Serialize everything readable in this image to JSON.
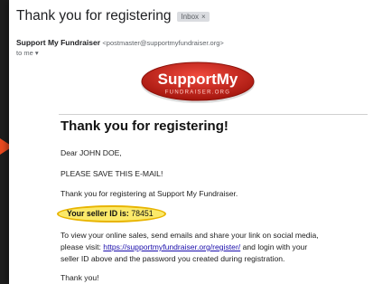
{
  "email": {
    "subject": "Thank you for registering",
    "label_badge": "Inbox",
    "label_close": "×",
    "sender_name": "Support My Fundraiser",
    "sender_email": "<postmaster@supportmyfundraiser.org>",
    "recipient": "to me ▾"
  },
  "logo": {
    "main": "SupportMy",
    "sub": "FUNDRAISER.ORG",
    "colors": {
      "oval": "#d9261c",
      "main_text": "#ffffff",
      "sub_text": "#ffd2cc"
    }
  },
  "body": {
    "heading": "Thank you for registering!",
    "greeting": "Dear JOHN DOE,",
    "save_notice": "PLEASE SAVE THIS E-MAIL!",
    "thanks_line": "Thank you for registering at Support My Fundraiser.",
    "seller_label": "Your seller ID is:",
    "seller_id": "78451",
    "instructions_1": "To view your online sales, send emails and share your link on social media,",
    "instructions_2_pre": "please visit: ",
    "instructions_link": "https://supportmyfundraiser.org/register/",
    "instructions_2_post": " and login with your",
    "instructions_3": "seller ID above and the password you created during registration.",
    "closing": "Thank you!"
  },
  "colors": {
    "arrow": "#ea4a1f",
    "highlight_fill": "#fbe96a",
    "highlight_border": "#e8b400",
    "link": "#1a0dab"
  }
}
